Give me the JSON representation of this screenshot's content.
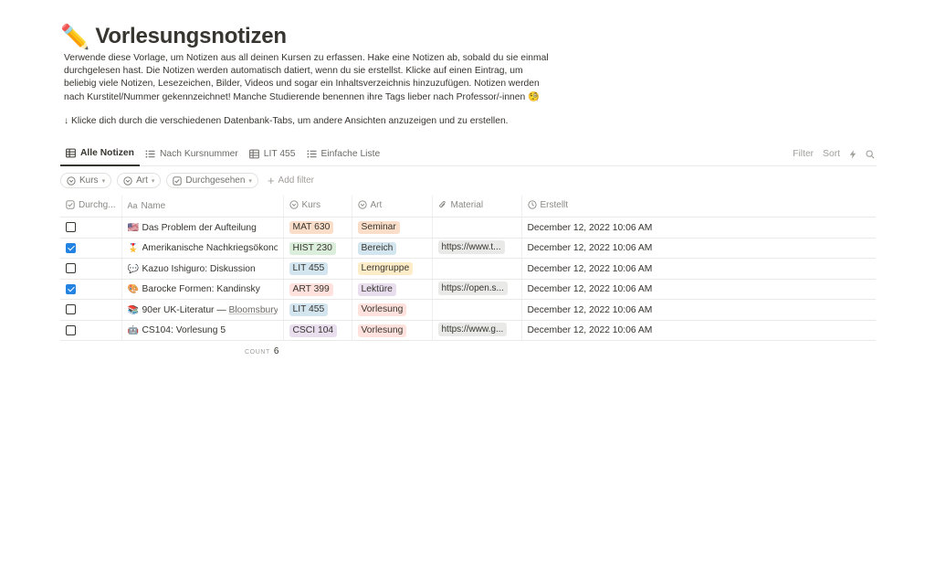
{
  "page": {
    "emoji": "✏️",
    "title": "Vorlesungsnotizen",
    "description": "Verwende diese Vorlage, um Notizen aus all deinen Kursen zu erfassen. Hake eine Notizen ab, sobald du sie einmal durchgelesen hast. Die Notizen werden automatisch datiert, wenn du sie erstellst. Klicke auf einen Eintrag, um beliebig viele Notizen, Lesezeichen, Bilder, Videos und sogar ein Inhaltsverzeichnis hinzuzufügen. Notizen werden nach Kurstitel/Nummer gekennzeichnet! Manche Studierende benennen ihre Tags lieber nach Professor/-innen 🧐",
    "hint": "↓ Klicke dich durch die verschiedenen Datenbank-Tabs, um andere Ansichten anzuzeigen und zu erstellen."
  },
  "tabs": [
    {
      "label": "Alle Notizen",
      "icon": "table-icon",
      "active": true
    },
    {
      "label": "Nach Kursnummer",
      "icon": "list-icon",
      "active": false
    },
    {
      "label": "LIT 455",
      "icon": "table-icon",
      "active": false
    },
    {
      "label": "Einfache Liste",
      "icon": "list-icon",
      "active": false
    }
  ],
  "toolbar": {
    "filter": "Filter",
    "sort": "Sort",
    "automation_icon": "lightning-icon",
    "search_icon": "search-icon"
  },
  "filters": [
    {
      "label": "Kurs",
      "icon": "select-icon"
    },
    {
      "label": "Art",
      "icon": "select-icon"
    },
    {
      "label": "Durchgesehen",
      "icon": "checkbox-icon"
    }
  ],
  "add_filter": "Add filter",
  "columns": [
    {
      "label": "Durchg...",
      "icon": "checkbox-icon"
    },
    {
      "label": "Name",
      "icon": "text-icon"
    },
    {
      "label": "Kurs",
      "icon": "select-icon"
    },
    {
      "label": "Art",
      "icon": "select-icon"
    },
    {
      "label": "Material",
      "icon": "paperclip-icon"
    },
    {
      "label": "Erstellt",
      "icon": "clock-icon"
    }
  ],
  "rows": [
    {
      "checked": false,
      "emoji": "🇺🇸",
      "name": "Das Problem der Aufteilung",
      "link": "",
      "kurs": "MAT 630",
      "kurs_color": "#fadec9",
      "art": "Seminar",
      "art_color": "#fadec9",
      "material": "",
      "erstellt": "December 12, 2022 10:06 AM"
    },
    {
      "checked": true,
      "emoji": "🎖️",
      "name": "Amerikanische Nachkriegsökonomie",
      "link": "",
      "kurs": "HIST 230",
      "kurs_color": "#dbeddb",
      "art": "Bereich",
      "art_color": "#d3e5ef",
      "material": "https://www.t...",
      "erstellt": "December 12, 2022 10:06 AM"
    },
    {
      "checked": false,
      "emoji": "💬",
      "name": "Kazuo Ishiguro: Diskussion",
      "link": "",
      "kurs": "LIT 455",
      "kurs_color": "#d3e5ef",
      "art": "Lerngruppe",
      "art_color": "#fdecc8",
      "material": "",
      "erstellt": "December 12, 2022 10:06 AM"
    },
    {
      "checked": true,
      "emoji": "🎨",
      "name": "Barocke Formen: Kandinsky",
      "link": "",
      "kurs": "ART 399",
      "kurs_color": "#ffe2dd",
      "art": "Lektüre",
      "art_color": "#e8deee",
      "material": "https://open.s...",
      "erstellt": "December 12, 2022 10:06 AM"
    },
    {
      "checked": false,
      "emoji": "📚",
      "name": "90er UK-Literatur — ",
      "link": "Bloomsbury",
      "kurs": "LIT 455",
      "kurs_color": "#d3e5ef",
      "art": "Vorlesung",
      "art_color": "#ffe2dd",
      "material": "",
      "erstellt": "December 12, 2022 10:06 AM"
    },
    {
      "checked": false,
      "emoji": "🤖",
      "name": "CS104: Vorlesung 5",
      "link": "",
      "kurs": "CSCI 104",
      "kurs_color": "#e8deee",
      "art": "Vorlesung",
      "art_color": "#ffe2dd",
      "material": "https://www.g...",
      "erstellt": "December 12, 2022 10:06 AM"
    }
  ],
  "footer": {
    "count_label": "COUNT",
    "count_value": "6"
  }
}
